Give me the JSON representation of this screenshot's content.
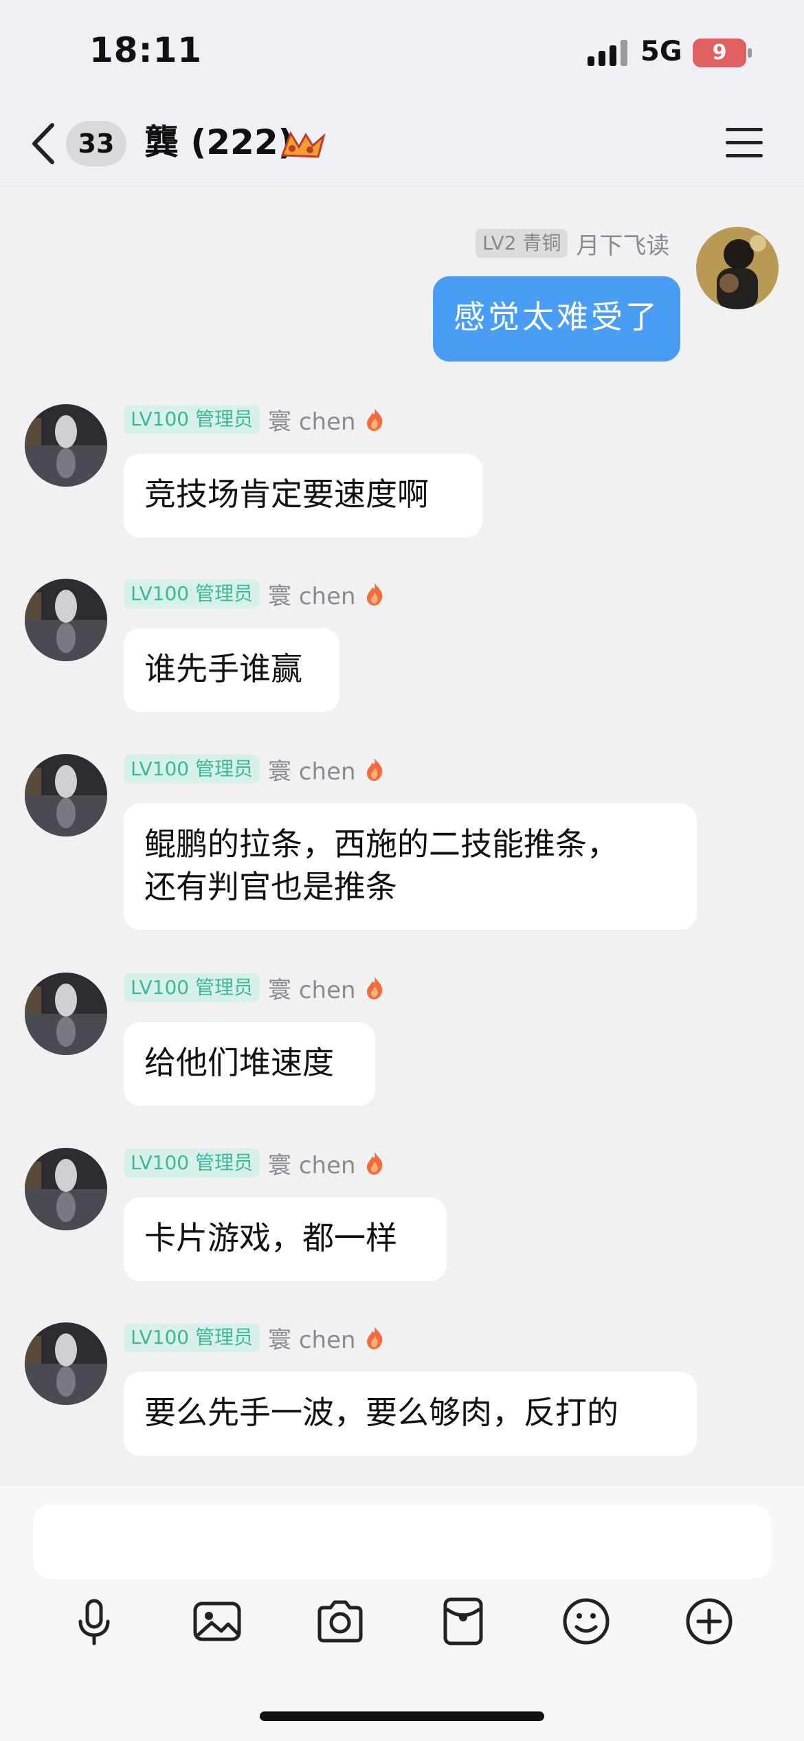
{
  "status_bar": {
    "time": "18:11",
    "network": "5G",
    "battery": "9"
  },
  "header": {
    "unread_count": "33",
    "title": "龔 (222)"
  },
  "messages": [
    {
      "side": "right",
      "level": "LV2 青铜",
      "name": "月下飞读",
      "text": "感觉太难受了"
    },
    {
      "side": "left",
      "level": "LV100 管理员",
      "name": "寰 chen",
      "text": "竞技场肯定要速度啊"
    },
    {
      "side": "left",
      "level": "LV100 管理员",
      "name": "寰 chen",
      "text": "谁先手谁赢"
    },
    {
      "side": "left",
      "level": "LV100 管理员",
      "name": "寰 chen",
      "text": "鲲鹏的拉条，西施的二技能推条，\n还有判官也是推条"
    },
    {
      "side": "left",
      "level": "LV100 管理员",
      "name": "寰 chen",
      "text": "给他们堆速度"
    },
    {
      "side": "left",
      "level": "LV100 管理员",
      "name": "寰 chen",
      "text": "卡片游戏，都一样"
    },
    {
      "side": "left",
      "level": "LV100 管理员",
      "name": "寰 chen",
      "text": "要么先手一波，要么够肉，反打的"
    }
  ],
  "input": {
    "placeholder": ""
  },
  "toolbar": [
    "microphone-icon",
    "image-icon",
    "camera-icon",
    "red-packet-icon",
    "emoji-icon",
    "plus-icon"
  ],
  "colors": {
    "accent_blue": "#4a9df5",
    "admin_green": "#3bb79b",
    "background": "#f1f1f3"
  }
}
